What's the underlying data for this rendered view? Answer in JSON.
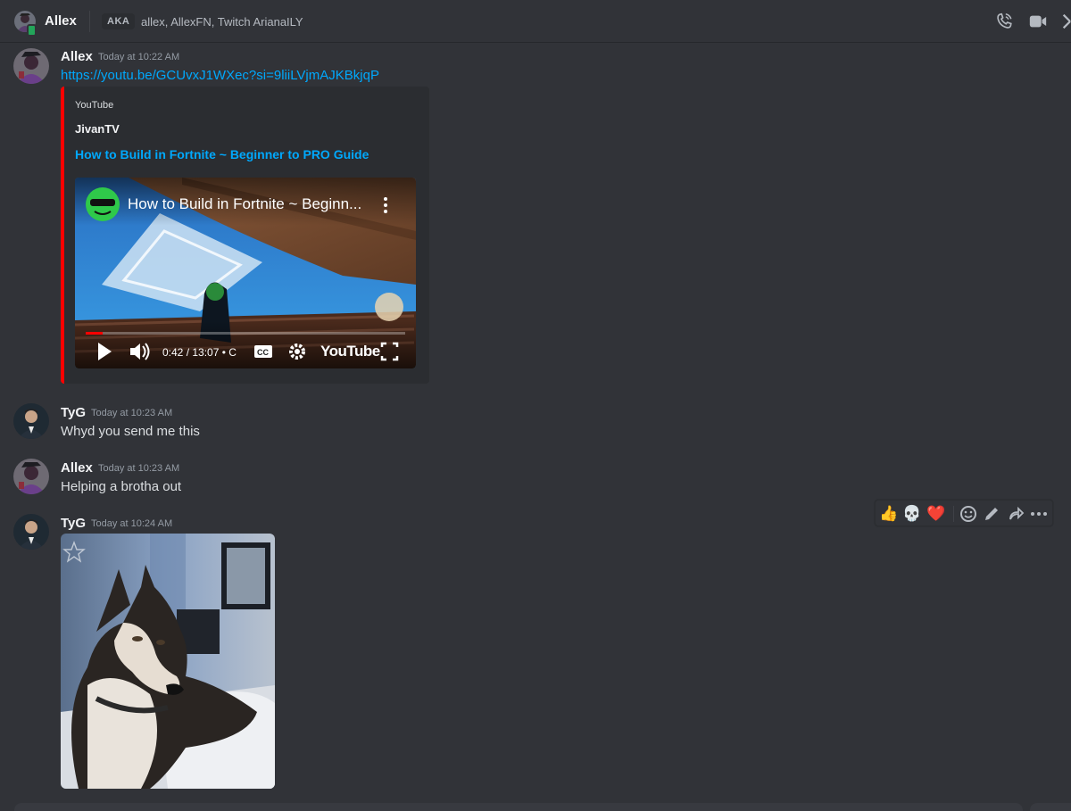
{
  "header": {
    "title": "Allex",
    "aka_label": "AKA",
    "aka_names": "allex, AllexFN, Twitch ArianaILY"
  },
  "messages": [
    {
      "author": "Allex",
      "timestamp": "Today at 10:22 AM",
      "link": "https://youtu.be/GCUvxJ1WXec?si=9liiLVjmAJKBkjqP",
      "embed": {
        "provider": "YouTube",
        "author": "JivanTV",
        "title": "How to Build in Fortnite ~ Beginner to PRO Guide",
        "video_title": "How to Build in Fortnite ~ Beginn...",
        "time": "0:42 / 13:07 • C",
        "youtube_label": "YouTube",
        "progress_fraction": 0.053
      }
    },
    {
      "author": "TyG",
      "timestamp": "Today at 10:23 AM",
      "text": "Whyd you send me this"
    },
    {
      "author": "Allex",
      "timestamp": "Today at 10:23 AM",
      "text": "Helping a brotha out"
    },
    {
      "author": "TyG",
      "timestamp": "Today at 10:24 AM",
      "attachment": "husky-dog-image"
    }
  ],
  "toolbar": {
    "reactions": [
      "👍",
      "💀",
      "❤️"
    ],
    "actions": [
      "add-reaction-icon",
      "edit-icon",
      "forward-icon",
      "more-icon"
    ]
  },
  "colors": {
    "background": "#313338",
    "link": "#00a8fc",
    "embed_bar": "#ff0000",
    "status": "#23a55a"
  }
}
